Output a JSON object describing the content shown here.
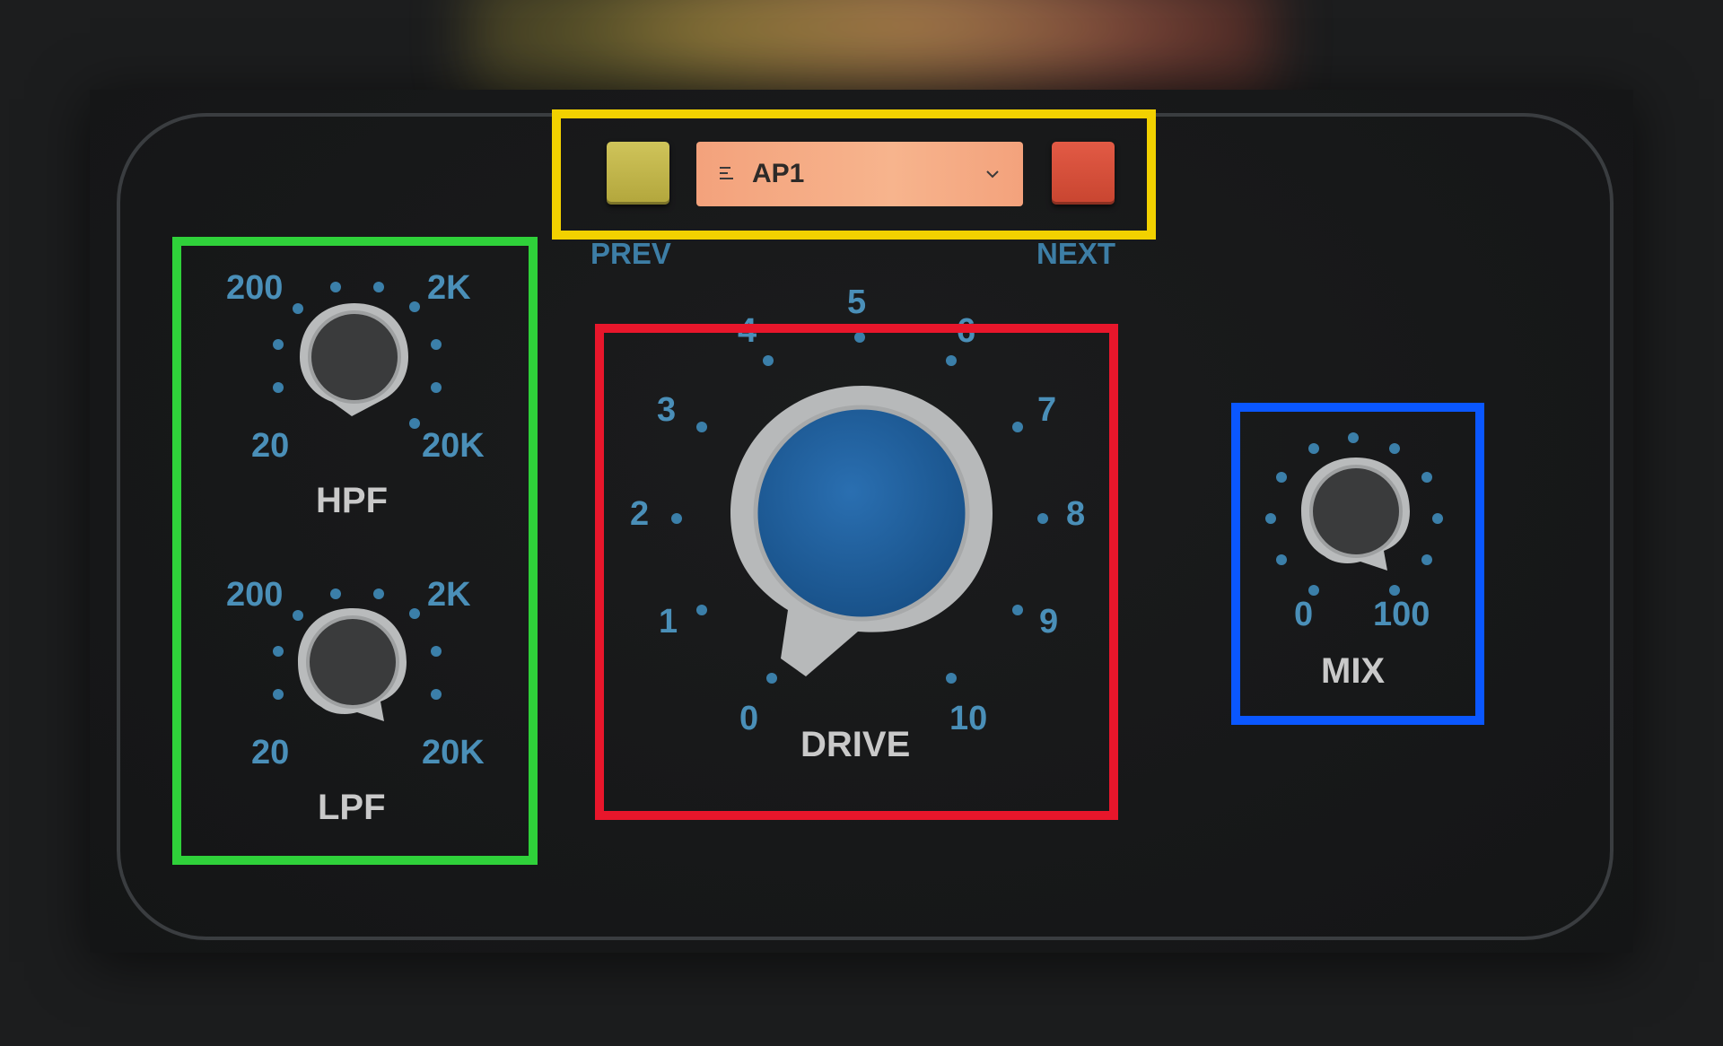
{
  "preset": {
    "name": "AP1",
    "prev_label": "PREV",
    "next_label": "NEXT",
    "prev_color": "#c7bc4f",
    "next_color": "#d8503b"
  },
  "hpf": {
    "label": "HPF",
    "scale_min": "20",
    "scale_mid_low": "200",
    "scale_mid_high": "2K",
    "scale_max": "20K"
  },
  "lpf": {
    "label": "LPF",
    "scale_min": "20",
    "scale_mid_low": "200",
    "scale_mid_high": "2K",
    "scale_max": "20K"
  },
  "drive": {
    "label": "DRIVE",
    "ticks": [
      "0",
      "1",
      "2",
      "3",
      "4",
      "5",
      "6",
      "7",
      "8",
      "9",
      "10"
    ],
    "cap_color": "#1e5f9e"
  },
  "mix": {
    "label": "MIX",
    "scale_min": "0",
    "scale_max": "100"
  },
  "icons": {
    "menu": "list-icon",
    "dropdown": "chevron-down-icon"
  },
  "annotation_colors": {
    "top": "#f2d100",
    "filters": "#2fd13a",
    "drive": "#e8162b",
    "mix": "#0a57ff"
  }
}
